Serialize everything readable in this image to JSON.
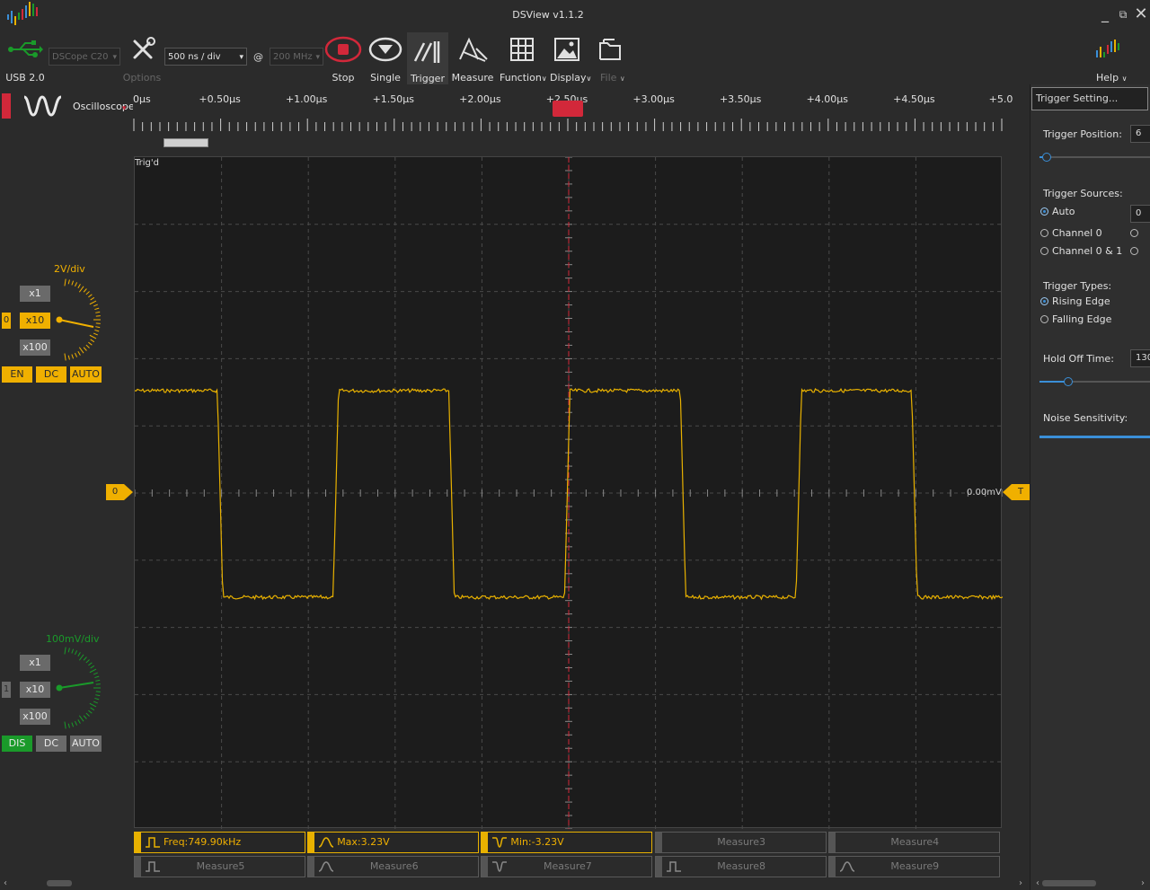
{
  "window": {
    "title": "DSView v1.1.2",
    "minimize": "_",
    "restore": "⧉",
    "close": "✕"
  },
  "toolbar": {
    "usb_label": "USB 2.0",
    "device_combo": "DSCope C20",
    "options_label": "Options",
    "timebase_combo": "500 ns / div",
    "at_sign": "@",
    "samplerate_combo": "200 MHz",
    "buttons": [
      "Stop",
      "Single",
      "Trigger",
      "Measure",
      "Function",
      "Display",
      "File"
    ],
    "help_label": "Help",
    "dropdown_arrow": "∨"
  },
  "mode": {
    "label": "Oscilloscope"
  },
  "ruler": {
    "labels": [
      "0μs",
      "+0.50μs",
      "+1.00μs",
      "+1.50μs",
      "+2.00μs",
      "+2.50μs",
      "+3.00μs",
      "+3.50μs",
      "+4.00μs",
      "+4.50μs",
      "+5.0"
    ]
  },
  "scope": {
    "status": "Trig'd",
    "zero_label": "0.00mV",
    "ch0_marker": "0",
    "trigger_marker": "T",
    "trace_color": "#e8b100",
    "grid_color": "#4a4a4a",
    "cursor_color": "#d2283a"
  },
  "channels": [
    {
      "id": "0",
      "scale": "2V/div",
      "probe_options": [
        "x1",
        "x10",
        "x100"
      ],
      "selected_probe": "x10",
      "enable": "EN",
      "coupling": "DC",
      "auto": "AUTO",
      "color": "#f0b000"
    },
    {
      "id": "1",
      "scale": "100mV/div",
      "probe_options": [
        "x1",
        "x10",
        "x100"
      ],
      "selected_probe": "x10",
      "enable": "DIS",
      "coupling": "DC",
      "auto": "AUTO",
      "color": "#1a9a2a"
    }
  ],
  "trigger_panel": {
    "title": "Trigger Setting...",
    "position_label": "Trigger Position:",
    "position_value": "6",
    "position_fraction": 0.06,
    "sources_label": "Trigger Sources:",
    "sources": [
      "Auto",
      "Channel 0",
      "Channel 0 & 1"
    ],
    "source_selected": "Auto",
    "source_extra_value": "0",
    "types_label": "Trigger Types:",
    "types": [
      "Rising Edge",
      "Falling Edge"
    ],
    "type_selected": "Rising Edge",
    "holdoff_label": "Hold Off Time:",
    "holdoff_value": "130",
    "holdoff_fraction": 0.25,
    "noise_label": "Noise Sensitivity:"
  },
  "measurements": [
    {
      "label": "Freq:749.90kHz",
      "active": true
    },
    {
      "label": "Max:3.23V",
      "active": true
    },
    {
      "label": "Min:-3.23V",
      "active": true
    },
    {
      "label": "Measure3",
      "active": false
    },
    {
      "label": "Measure4",
      "active": false
    },
    {
      "label": "Measure5",
      "active": false
    },
    {
      "label": "Measure6",
      "active": false
    },
    {
      "label": "Measure7",
      "active": false
    },
    {
      "label": "Measure8",
      "active": false
    },
    {
      "label": "Measure9",
      "active": false
    }
  ]
}
